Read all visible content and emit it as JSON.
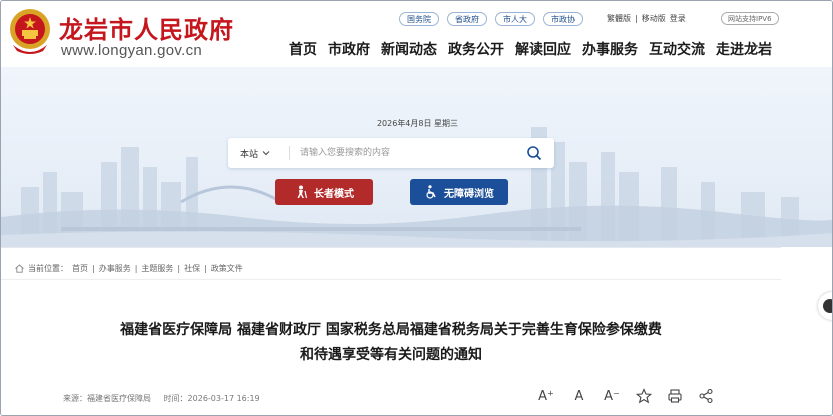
{
  "header": {
    "site_name": "龙岩市人民政府",
    "site_url": "www.longyan.gov.cn",
    "top_links": [
      "国务院",
      "省政府",
      "市人大",
      "市政协"
    ],
    "util": {
      "traditional": "繁體版",
      "sep": "|",
      "mobile": "移动版",
      "login": "登录"
    },
    "ipv6": "网站支持IPV6",
    "nav": [
      "首页",
      "市政府",
      "新闻动态",
      "政务公开",
      "解读回应",
      "办事服务",
      "互动交流",
      "走进龙岩"
    ]
  },
  "banner": {
    "date": "2026年4月8日 星期三",
    "search": {
      "scope": "本站",
      "placeholder": "请输入您要搜索的内容"
    },
    "elder_button": "长者模式",
    "access_button": "无障碍浏览"
  },
  "article": {
    "breadcrumb": [
      "当前位置：",
      "首页",
      "办事服务",
      "主题服务",
      "社保",
      "政策文件"
    ],
    "breadcrumb_sep": " | ",
    "title_line1": "福建省医疗保障局 福建省财政厅 国家税务总局福建省税务局关于完善生育保险参保缴费",
    "title_line2": "和待遇享受等有关问题的通知",
    "source": "来源：福建省医疗保障局",
    "time": "时间：2026-03-17 16:19",
    "tools": {
      "font_up": "A⁺",
      "font_normal": "A",
      "font_down": "A⁻"
    }
  },
  "colors": {
    "brand_red": "#c4161c",
    "elder_red": "#b22a2a",
    "access_blue": "#1c4f99"
  }
}
